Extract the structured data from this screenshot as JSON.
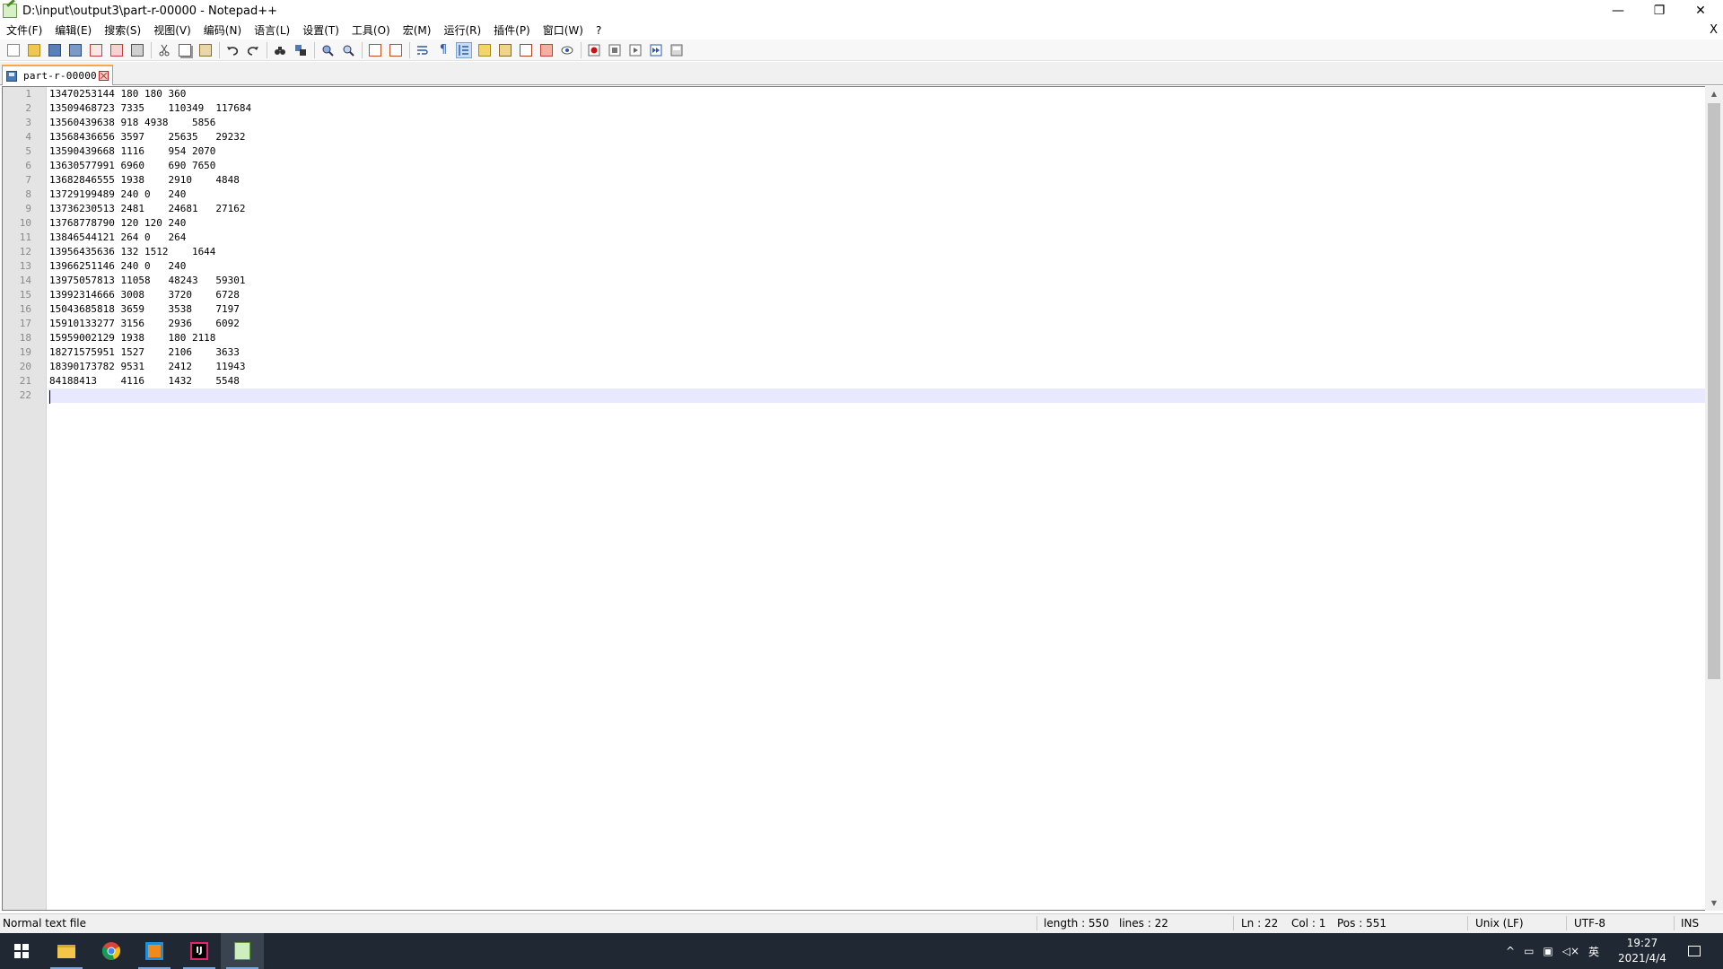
{
  "window": {
    "title": "D:\\input\\output3\\part-r-00000 - Notepad++",
    "minimize": "—",
    "restore": "❐",
    "close": "✕",
    "doc_close": "X"
  },
  "menu": [
    "文件(F)",
    "编辑(E)",
    "搜索(S)",
    "视图(V)",
    "编码(N)",
    "语言(L)",
    "设置(T)",
    "工具(O)",
    "宏(M)",
    "运行(R)",
    "插件(P)",
    "窗口(W)",
    "?"
  ],
  "tab": {
    "label": "part-r-00000"
  },
  "editor": {
    "lines": [
      "13470253144 180 180 360",
      "13509468723 7335    110349  117684",
      "13560439638 918 4938    5856",
      "13568436656 3597    25635   29232",
      "13590439668 1116    954 2070",
      "13630577991 6960    690 7650",
      "13682846555 1938    2910    4848",
      "13729199489 240 0   240",
      "13736230513 2481    24681   27162",
      "13768778790 120 120 240",
      "13846544121 264 0   264",
      "13956435636 132 1512    1644",
      "13966251146 240 0   240",
      "13975057813 11058   48243   59301",
      "13992314666 3008    3720    6728",
      "15043685818 3659    3538    7197",
      "15910133277 3156    2936    6092",
      "15959002129 1938    180 2118",
      "18271575951 1527    2106    3633",
      "18390173782 9531    2412    11943",
      "84188413    4116    1432    5548",
      ""
    ],
    "line_numbers": [
      "1",
      "2",
      "3",
      "4",
      "5",
      "6",
      "7",
      "8",
      "9",
      "10",
      "11",
      "12",
      "13",
      "14",
      "15",
      "16",
      "17",
      "18",
      "19",
      "20",
      "21",
      "22"
    ],
    "current_line": 22
  },
  "status": {
    "file_type": "Normal text file",
    "length": "length : 550",
    "lines": "lines : 22",
    "ln": "Ln : 22",
    "col": "Col : 1",
    "pos": "Pos : 551",
    "eol": "Unix (LF)",
    "encoding": "UTF-8",
    "mode": "INS"
  },
  "taskbar": {
    "ime": "英",
    "time": "19:27",
    "date": "2021/4/4"
  },
  "colors": {
    "current_line": "#e8e8ff",
    "tab_accent": "#f8a848",
    "taskbar": "#1f2833"
  }
}
